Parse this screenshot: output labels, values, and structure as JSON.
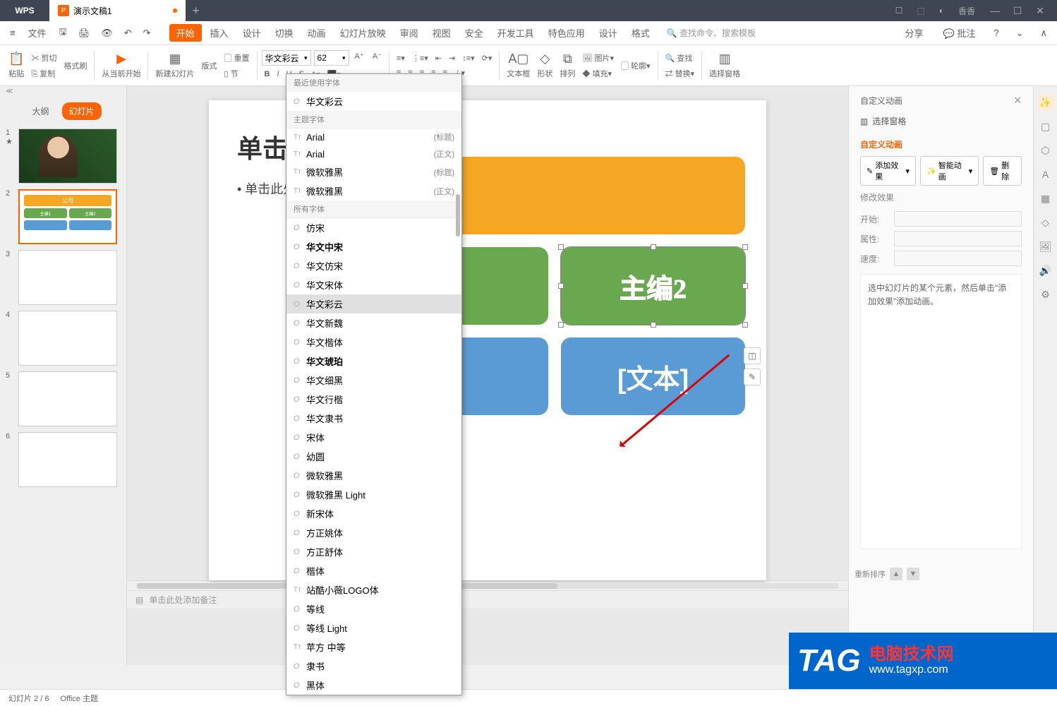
{
  "app": {
    "name": "WPS",
    "doc_tab": "演示文稿1",
    "user": "香香"
  },
  "menubar": {
    "file": "文件",
    "items": [
      "开始",
      "插入",
      "设计",
      "切换",
      "动画",
      "幻灯片放映",
      "审阅",
      "视图",
      "安全",
      "开发工具",
      "特色应用",
      "设计",
      "格式"
    ],
    "active": "开始",
    "search_placeholder": "查找命令、搜索模板",
    "share": "分享",
    "comment": "批注"
  },
  "toolbar": {
    "paste": "粘贴",
    "cut": "剪切",
    "copy": "复制",
    "format_painter": "格式刷",
    "from_start": "从当前开始",
    "new_slide": "新建幻灯片",
    "layout": "版式",
    "section": "节",
    "reset": "重置",
    "font_name": "华文彩云",
    "font_size": "62",
    "text_box": "文本框",
    "shapes": "形状",
    "arrange": "排列",
    "pictures": "图片",
    "fill": "填充",
    "outline": "轮廓",
    "find": "查找",
    "replace": "替换",
    "select_pane": "选择窗格"
  },
  "left_panel": {
    "outline": "大纲",
    "slides": "幻灯片",
    "thumb2": {
      "top": "公司",
      "mid1": "主编1",
      "mid2": "主编2"
    }
  },
  "font_dropdown": {
    "recent_header": "最近使用字体",
    "recent": [
      {
        "name": "华文彩云"
      }
    ],
    "theme_header": "主题字体",
    "theme": [
      {
        "name": "Arial",
        "role": "(标题)"
      },
      {
        "name": "Arial",
        "role": "(正文)"
      },
      {
        "name": "微软雅黑",
        "role": "(标题)"
      },
      {
        "name": "微软雅黑",
        "role": "(正文)"
      }
    ],
    "all_header": "所有字体",
    "all": [
      "仿宋",
      "华文中宋",
      "华文仿宋",
      "华文宋体",
      "华文彩云",
      "华文新魏",
      "华文楷体",
      "华文琥珀",
      "华文细黑",
      "华文行楷",
      "华文隶书",
      "宋体",
      "幼圆",
      "微软雅黑",
      "微软雅黑 Light",
      "新宋体",
      "方正姚体",
      "方正舒体",
      "楷体",
      "站酷小薇LOGO体",
      "等线",
      "等线 Light",
      "苹方 中等",
      "隶书",
      "黑体"
    ],
    "highlighted": "华文彩云"
  },
  "slide": {
    "title": "单击此处添加",
    "bullet": "• 单击此处添",
    "green_box": "主编2",
    "blue_left": "]",
    "blue_right": "[文本]"
  },
  "notes": {
    "placeholder": "单击此处添加备注"
  },
  "right_panel": {
    "header": "自定义动画",
    "select_pane": "选择窗格",
    "title": "自定义动画",
    "add_effect": "添加效果",
    "smart_anim": "智能动画",
    "delete": "删除",
    "modify": "修改效果",
    "start_label": "开始:",
    "property_label": "属性:",
    "speed_label": "速度:",
    "hint": "选中幻灯片的某个元素，然后单击\"添加效果\"添加动画。",
    "reorder": "重新排序"
  },
  "statusbar": {
    "slide_info": "幻灯片 2 / 6",
    "theme": "Office 主题"
  },
  "watermark": {
    "tag": "TAG",
    "cn": "电脑技术网",
    "url": "www.tagxp.com"
  }
}
